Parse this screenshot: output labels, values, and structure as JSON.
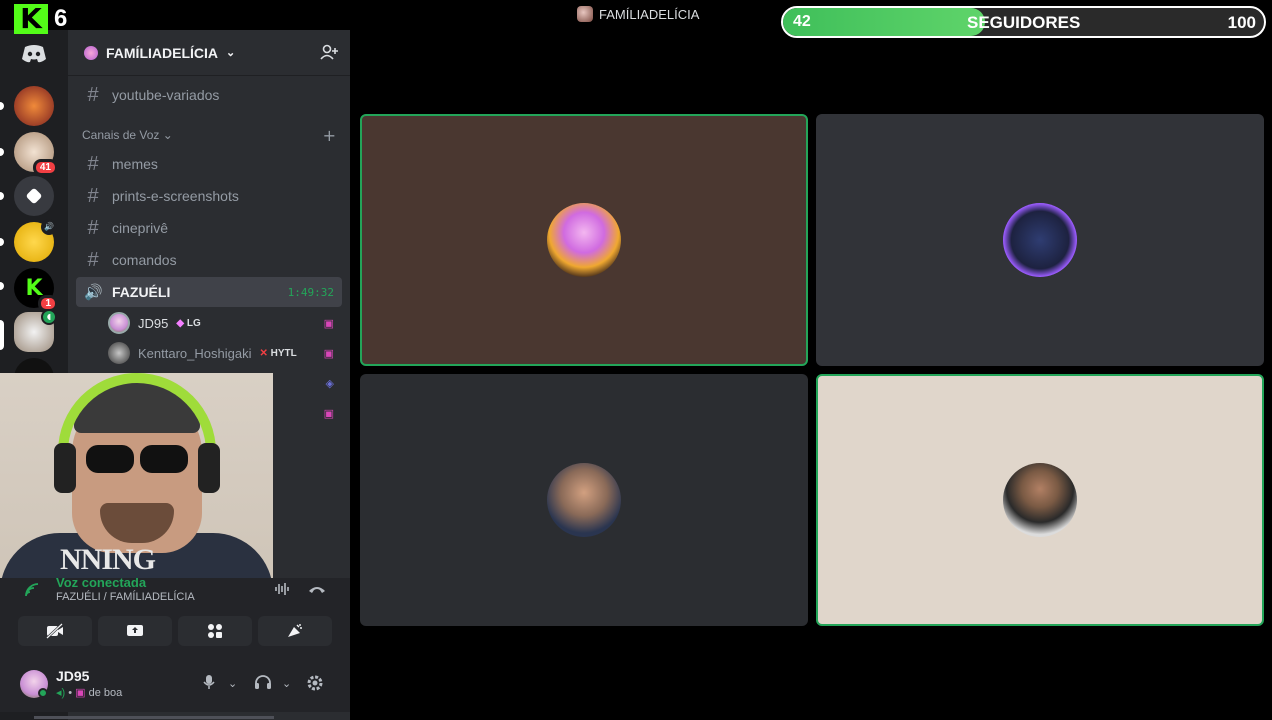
{
  "overlay": {
    "kick_count": "6",
    "followers": {
      "current": "42",
      "label": "SEGUIDORES",
      "goal": "100",
      "progress_fraction": 0.42
    }
  },
  "titlebar": {
    "server_name": "FAMÍLIADELÍCIA"
  },
  "server": {
    "name": "FAMÍLIADELÍCIA"
  },
  "channels": {
    "top": [
      {
        "label": "youtube-variados"
      }
    ],
    "category": "Canais de Voz",
    "list": [
      {
        "label": "memes"
      },
      {
        "label": "prints-e-screenshots"
      },
      {
        "label": "cineprivê"
      },
      {
        "label": "comandos"
      }
    ],
    "active_voice": {
      "label": "FAZUÉLI",
      "timer": "1:49:32"
    }
  },
  "voice_users": [
    {
      "name": "JD95",
      "tag": "LG"
    },
    {
      "name": "Kenttaro_Hoshigaki",
      "tag": "HYTL"
    }
  ],
  "rail": {
    "badge_1": "41",
    "badge_2": "1"
  },
  "voice_panel": {
    "status": "Voz conectada",
    "location": "FAZUÉLI / FAMÍLIADELÍCIA"
  },
  "user_panel": {
    "name": "JD95",
    "status": "de boa"
  },
  "webcam": {
    "shirt_text": "NNING"
  },
  "colors": {
    "accent_green": "#23a559",
    "kick_green": "#53fc18",
    "tile_brown": "#4a3730",
    "tile_dark": "#2b2d31",
    "tile_beige": "#e0d6cb"
  }
}
